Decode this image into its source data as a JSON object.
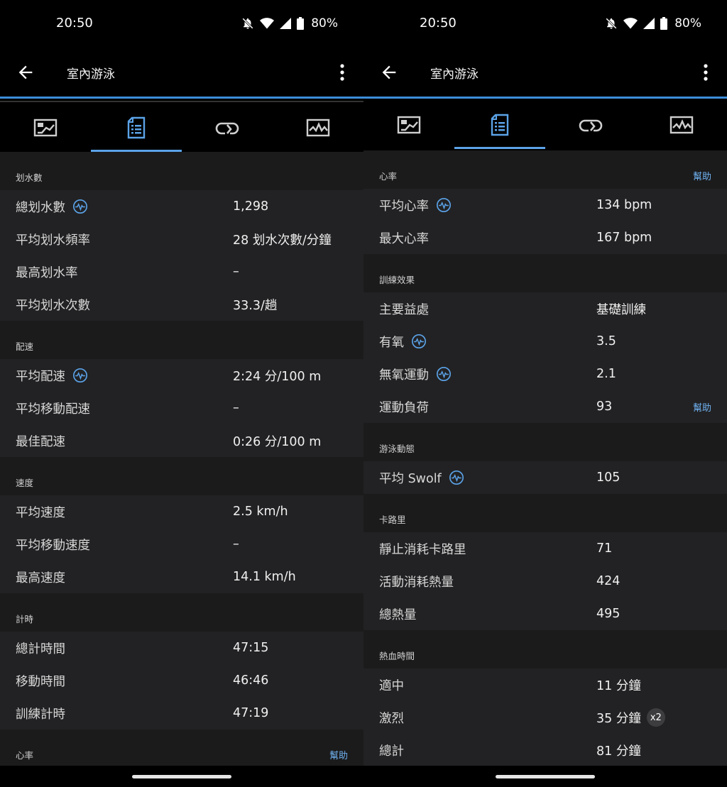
{
  "left": {
    "status": {
      "time": "20:50",
      "battery": "80%"
    },
    "title": "室內游泳",
    "tabs": [
      "stats-chart-icon",
      "details-icon",
      "laps-icon",
      "graphs-icon"
    ],
    "sections": [
      {
        "label": "划水數",
        "help": "",
        "rows": [
          {
            "k": "總划水數",
            "v": "1,298",
            "icon": true
          },
          {
            "k": "平均划水頻率",
            "v": "28 划水次數/分鐘"
          },
          {
            "k": "最高划水率",
            "v": "–"
          },
          {
            "k": "平均划水次數",
            "v": "33.3/趟"
          }
        ]
      },
      {
        "label": "配速",
        "help": "",
        "rows": [
          {
            "k": "平均配速",
            "v": "2:24 分/100 m",
            "icon": true
          },
          {
            "k": "平均移動配速",
            "v": "–"
          },
          {
            "k": "最佳配速",
            "v": "0:26 分/100 m"
          }
        ]
      },
      {
        "label": "速度",
        "help": "",
        "rows": [
          {
            "k": "平均速度",
            "v": "2.5 km/h"
          },
          {
            "k": "平均移動速度",
            "v": "–"
          },
          {
            "k": "最高速度",
            "v": "14.1 km/h"
          }
        ]
      },
      {
        "label": "計時",
        "help": "",
        "rows": [
          {
            "k": "總計時間",
            "v": "47:15"
          },
          {
            "k": "移動時間",
            "v": "46:46"
          },
          {
            "k": "訓練計時",
            "v": "47:19"
          }
        ]
      },
      {
        "label": "心率",
        "help": "幫助",
        "rows": []
      }
    ]
  },
  "right": {
    "status": {
      "time": "20:50",
      "battery": "80%"
    },
    "title": "室內游泳",
    "tabs": [
      "stats-chart-icon",
      "details-icon",
      "laps-icon",
      "graphs-icon"
    ],
    "sections": [
      {
        "label": "心率",
        "help": "幫助",
        "rows": [
          {
            "k": "平均心率",
            "v": "134 bpm",
            "icon": true
          },
          {
            "k": "最大心率",
            "v": "167 bpm"
          }
        ]
      },
      {
        "label": "訓練效果",
        "help": "",
        "rows": [
          {
            "k": "主要益處",
            "v": "基礎訓練"
          },
          {
            "k": "有氧",
            "v": "3.5",
            "icon": true
          },
          {
            "k": "無氧運動",
            "v": "2.1",
            "icon": true
          },
          {
            "k": "運動負荷",
            "v": "93",
            "help": "幫助"
          }
        ]
      },
      {
        "label": "游泳動態",
        "help": "",
        "rows": [
          {
            "k": "平均 Swolf",
            "v": "105",
            "icon": true
          }
        ]
      },
      {
        "label": "卡路里",
        "help": "",
        "rows": [
          {
            "k": "靜止消耗卡路里",
            "v": "71"
          },
          {
            "k": "活動消耗熱量",
            "v": "424"
          },
          {
            "k": "總熱量",
            "v": "495"
          }
        ]
      },
      {
        "label": "熱血時間",
        "help": "",
        "rows": [
          {
            "k": "適中",
            "v": "11 分鐘"
          },
          {
            "k": "激烈",
            "v": "35 分鐘",
            "badge": "x2"
          },
          {
            "k": "總計",
            "v": "81 分鐘"
          }
        ]
      }
    ]
  },
  "colors": {
    "accent": "#5ba3e8",
    "background": "#000000",
    "row_bg": "#222224",
    "header_bg": "#1b1b1c"
  }
}
